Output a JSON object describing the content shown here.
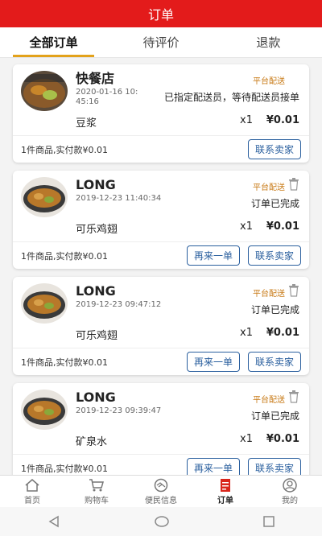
{
  "header": {
    "title": "订单"
  },
  "tabs": [
    {
      "label": "全部订单"
    },
    {
      "label": "待评价"
    },
    {
      "label": "退款"
    }
  ],
  "orders": [
    {
      "shop": "快餐店",
      "time": "2020-01-16 10:45:16",
      "badge": "平台配送",
      "status": "已指定配送员，等待配送员接单",
      "item": "豆浆",
      "qty": "x1",
      "price": "¥0.01",
      "summary": "1件商品,实付款¥0.01",
      "contact_label": "联系卖家",
      "show_trash": false
    },
    {
      "shop": "LONG",
      "time": "2019-12-23 11:40:34",
      "badge": "平台配送",
      "status": "订单已完成",
      "item": "可乐鸡翅",
      "qty": "x1",
      "price": "¥0.01",
      "summary": "1件商品,实付款¥0.01",
      "reorder_label": "再来一单",
      "contact_label": "联系卖家",
      "show_trash": true
    },
    {
      "shop": "LONG",
      "time": "2019-12-23 09:47:12",
      "badge": "平台配送",
      "status": "订单已完成",
      "item": "可乐鸡翅",
      "qty": "x1",
      "price": "¥0.01",
      "summary": "1件商品,实付款¥0.01",
      "reorder_label": "再来一单",
      "contact_label": "联系卖家",
      "show_trash": true
    },
    {
      "shop": "LONG",
      "time": "2019-12-23 09:39:47",
      "badge": "平台配送",
      "status": "订单已完成",
      "item": "矿泉水",
      "qty": "x1",
      "price": "¥0.01",
      "summary": "1件商品,实付款¥0.01",
      "reorder_label": "再来一单",
      "contact_label": "联系卖家",
      "show_trash": true
    }
  ],
  "navbar": [
    {
      "label": "首页",
      "icon": "home-icon"
    },
    {
      "label": "购物车",
      "icon": "cart-icon"
    },
    {
      "label": "便民信息",
      "icon": "handshake-icon"
    },
    {
      "label": "订单",
      "icon": "order-icon"
    },
    {
      "label": "我的",
      "icon": "profile-icon"
    }
  ],
  "colors": {
    "primary": "#e31b1b",
    "accent": "#e3a21b",
    "button": "#2a5f9e",
    "badge": "#c87a16"
  }
}
